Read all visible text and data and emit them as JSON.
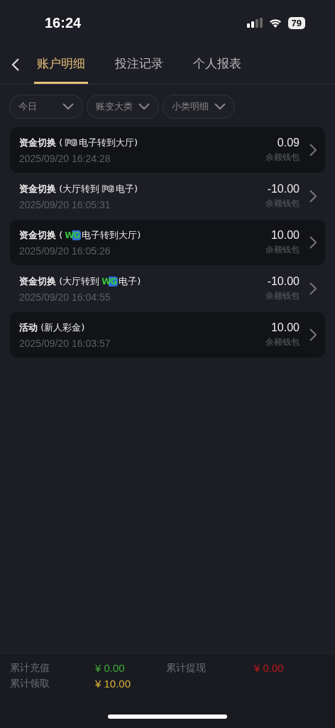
{
  "status_bar": {
    "time": "16:24",
    "battery": "79"
  },
  "tabs": [
    {
      "label": "账户明细",
      "selected": true
    },
    {
      "label": "投注记录",
      "selected": false
    },
    {
      "label": "个人报表",
      "selected": false
    }
  ],
  "filters": [
    {
      "label": "今日"
    },
    {
      "label": "账变大类"
    },
    {
      "label": "小类明细"
    }
  ],
  "records": [
    {
      "title_before": "**资金切换** (",
      "logo": {
        "text": "PG",
        "kind": "outline"
      },
      "title_after": "电子转到大厅)",
      "time": "2025/09/20 16:24:28",
      "amount": "0.09",
      "wallet": "余额钱包",
      "shaded": true
    },
    {
      "title_before": "**资金切换** (大厅转到",
      "logo": {
        "text": "PG",
        "kind": "outline"
      },
      "title_after": "电子)",
      "time": "2025/09/20 16:05:31",
      "amount": "-10.00",
      "wallet": "余额钱包",
      "shaded": false
    },
    {
      "title_before": "**资金切换** (",
      "logo": {
        "text": "WG",
        "kind": "color"
      },
      "title_after": "电子转到大厅)",
      "time": "2025/09/20 16:05:26",
      "amount": "10.00",
      "wallet": "余额钱包",
      "shaded": true
    },
    {
      "title_before": "**资金切换** (大厅转到",
      "logo": {
        "text": "WG",
        "kind": "color"
      },
      "title_after": "电子)",
      "time": "2025/09/20 16:04:55",
      "amount": "-10.00",
      "wallet": "余额钱包",
      "shaded": false
    },
    {
      "title_before": "**活动** (新人彩金)",
      "time": "2025/09/20 16:03:57",
      "amount": "10.00",
      "wallet": "余额钱包",
      "shaded": true
    }
  ],
  "totals": [
    {
      "label": "累计充值",
      "value": "¥ 0.00",
      "color": "#3fae3a"
    },
    {
      "label": "累计提现",
      "value": "¥ 0.00",
      "color": "#c0191d"
    },
    {
      "label": "累计领取",
      "value": "¥ 10.00",
      "color": "#e2b43a"
    }
  ]
}
